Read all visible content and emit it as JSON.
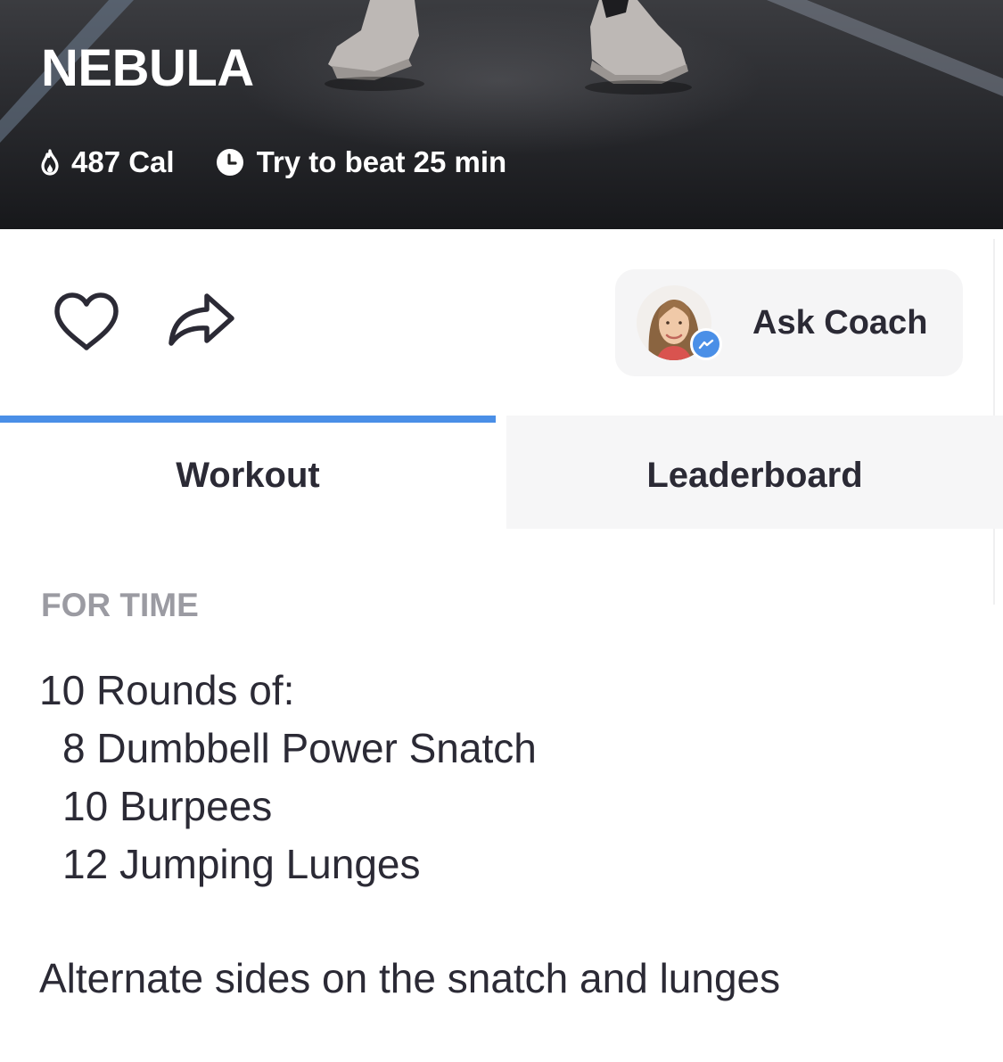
{
  "hero": {
    "title": "NEBULA",
    "calories": "487 Cal",
    "target_time": "Try to beat 25 min"
  },
  "actions": {
    "favorite_icon": "heart-icon",
    "share_icon": "share-arrow-icon",
    "coach_label": "Ask Coach",
    "coach_badge_icon": "messenger-icon"
  },
  "tabs": [
    {
      "label": "Workout",
      "active": true
    },
    {
      "label": "Leaderboard",
      "active": false
    }
  ],
  "workout": {
    "format": "FOR TIME",
    "rounds": "10 Rounds of:",
    "movements": [
      "8 Dumbbell Power Snatch",
      "10 Burpees",
      "12 Jumping Lunges"
    ],
    "note": "Alternate sides on the snatch and lunges"
  },
  "colors": {
    "accent": "#4a8fe7",
    "text": "#2b2a35",
    "muted": "#9b9ba2",
    "tab_inactive_bg": "#f6f6f7"
  }
}
